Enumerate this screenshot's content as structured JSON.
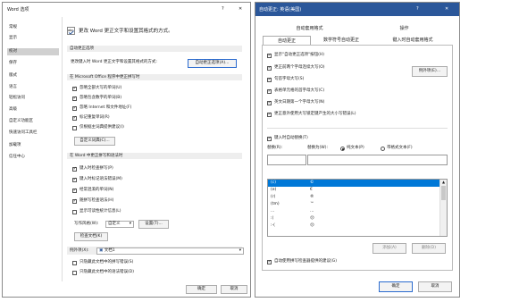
{
  "word_dialog": {
    "title": "Word 选项",
    "help": "?",
    "close": "✕",
    "sidebar": [
      "常规",
      "显示",
      "校对",
      "保存",
      "版式",
      "语言",
      "轻松访问",
      "高级",
      "自定义功能区",
      "快速访问工具栏",
      "加载项",
      "信任中心"
    ],
    "selected_index": 2,
    "header_text": "更改 Word 更正文字和设置其格式的方式。",
    "autocorrect_section": "自动更正选项",
    "autocorrect_desc": "更改键入时 Word 更正文字和设置其格式的方式:",
    "autocorrect_button": "自动更正选项(A)...",
    "office_section": "在 Microsoft Office 程序中更正拼写时",
    "office_options": [
      {
        "label": "忽略全部大写的单词(U)",
        "checked": true
      },
      {
        "label": "忽略包含数字的单词(B)",
        "checked": true
      },
      {
        "label": "忽略 Internet 和文件地址(F)",
        "checked": true
      },
      {
        "label": "标记重复单词(R)",
        "checked": true
      },
      {
        "label": "仅根据主词典提供建议(I)",
        "checked": false
      }
    ],
    "custom_dict_button": "自定义词典(C)...",
    "word_section": "在 Word 中更正拼写和语法时",
    "word_options": [
      {
        "label": "键入时检查拼写(P)",
        "checked": true
      },
      {
        "label": "键入时标记语法错误(M)",
        "checked": true
      },
      {
        "label": "经常混淆的单词(N)",
        "checked": true
      },
      {
        "label": "随拼写检查语法(H)",
        "checked": true
      },
      {
        "label": "显示可读性统计信息(L)",
        "checked": false
      }
    ],
    "writing_style_label": "写作风格(W):",
    "writing_style_value": "自定义",
    "settings_button": "设置(T)...",
    "check_doc_button": "检查文档(K)",
    "exceptions_label": "例外项(X):",
    "exceptions_value": "文档1",
    "exceptions_options": [
      {
        "label": "只隐藏此文档中的拼写错误(S)",
        "checked": false
      },
      {
        "label": "只隐藏此文档中的语法错误(D)",
        "checked": false
      }
    ],
    "ok": "确定",
    "cancel": "取消"
  },
  "autocorrect_dialog": {
    "title": "自动更正: 英语(美国)",
    "help": "?",
    "close": "✕",
    "tabs_row1": [
      "自动套用格式",
      "操作"
    ],
    "tabs_row2": [
      "自动更正",
      "数学符号自动更正",
      "键入时自动套用格式"
    ],
    "active_tab": "自动更正",
    "options": [
      {
        "label": "显示\"自动更正选项\"按钮(H)",
        "checked": true
      },
      {
        "label": "更正前两个字母连续大写(O)",
        "checked": true
      },
      {
        "label": "句首字母大写(S)",
        "checked": true
      },
      {
        "label": "表格单元格的首字母大写(C)",
        "checked": true
      },
      {
        "label": "英文日期第一个字母大写(N)",
        "checked": true
      },
      {
        "label": "更正意外使用大写锁定键产生的大小写错误(L)",
        "checked": true
      }
    ],
    "exceptions_button": "例外项(E)...",
    "replace_checkbox": {
      "label": "键入时自动替换(T)",
      "checked": true
    },
    "replace_label": "替换(R):",
    "with_label": "替换为(W):",
    "plain_text": "纯文本(P)",
    "formatted_text": "带格式文本(F)",
    "rows": [
      {
        "a": "(c)",
        "b": "©"
      },
      {
        "a": "(e)",
        "b": "€"
      },
      {
        "a": "(r)",
        "b": "®"
      },
      {
        "a": "(tm)",
        "b": "™"
      },
      {
        "a": "...",
        "b": "…"
      },
      {
        "a": ":(",
        "b": "☹"
      },
      {
        "a": ":-(",
        "b": "☹"
      }
    ],
    "add_button": "添加(A)",
    "delete_button": "删除(D)",
    "spell_checker_option": {
      "label": "自动使用拼写检查器提供的建议(G)",
      "checked": true
    },
    "ok": "确定",
    "cancel": "取消"
  },
  "colors": {
    "accent": "#0078d7",
    "title_bg": "#2b579a"
  }
}
